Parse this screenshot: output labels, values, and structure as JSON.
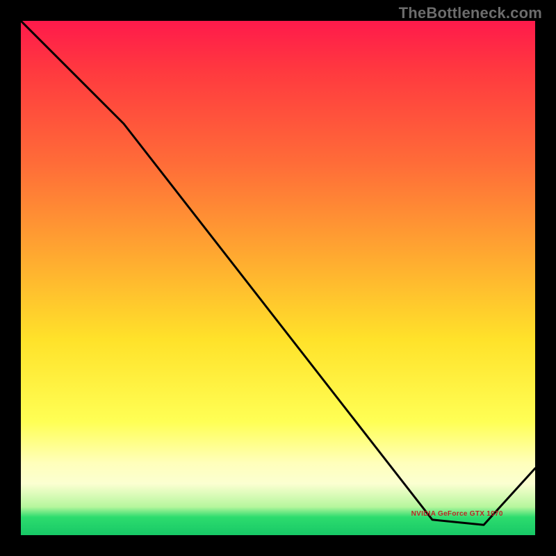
{
  "watermark": "TheBottleneck.com",
  "annotation_text": "NVIDIA GeForce GTX 1070",
  "chart_data": {
    "type": "line",
    "title": "",
    "xlabel": "",
    "ylabel": "",
    "x": [
      0,
      20,
      80,
      90,
      100
    ],
    "y": [
      100,
      80,
      3,
      2,
      13
    ],
    "xlim": [
      0,
      100
    ],
    "ylim": [
      0,
      100
    ],
    "grid": false,
    "legend": false,
    "gradient_stops": [
      {
        "pct": 0,
        "color": "#ff1a4b"
      },
      {
        "pct": 10,
        "color": "#ff3a3f"
      },
      {
        "pct": 28,
        "color": "#ff6d38"
      },
      {
        "pct": 44,
        "color": "#ffa331"
      },
      {
        "pct": 62,
        "color": "#ffe22a"
      },
      {
        "pct": 78,
        "color": "#ffff55"
      },
      {
        "pct": 86,
        "color": "#ffffbb"
      },
      {
        "pct": 90,
        "color": "#fbffd1"
      },
      {
        "pct": 94.5,
        "color": "#b6f69d"
      },
      {
        "pct": 96.5,
        "color": "#2ddc6e"
      },
      {
        "pct": 100,
        "color": "#17c866"
      }
    ],
    "annotations": [
      {
        "text_key": "annotation_text",
        "x": 84,
        "y": 4
      }
    ]
  }
}
